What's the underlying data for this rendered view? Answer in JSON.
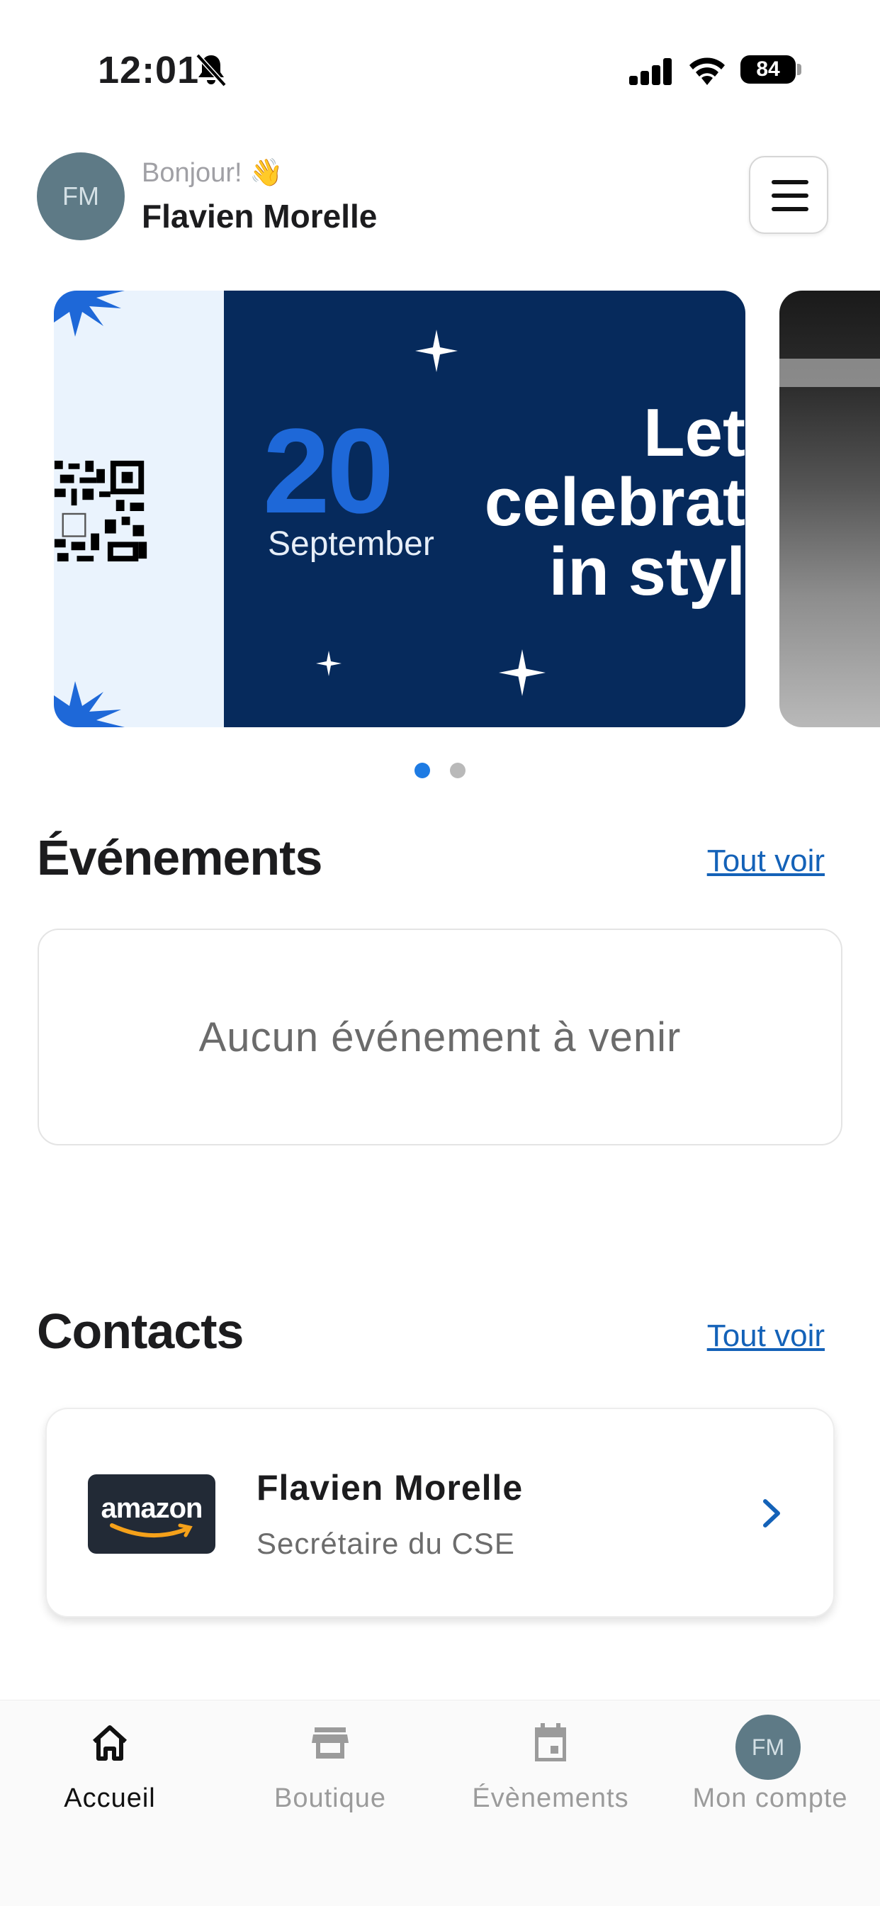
{
  "status_bar": {
    "time": "12:01",
    "battery": "84"
  },
  "header": {
    "avatar_initials": "FM",
    "greeting": "Bonjour! 👋",
    "user_name": "Flavien Morelle"
  },
  "carousel": {
    "banners": [
      {
        "day": "20",
        "month": "September",
        "tagline": "Let\ncelebrat\nin styl"
      }
    ],
    "page_count": 2,
    "active_index": 0
  },
  "events": {
    "title": "Événements",
    "see_all": "Tout voir",
    "empty_message": "Aucun événement à venir"
  },
  "contacts": {
    "title": "Contacts",
    "see_all": "Tout voir",
    "items": [
      {
        "logo_text": "amazon",
        "name": "Flavien Morelle",
        "role": "Secrétaire du CSE"
      }
    ]
  },
  "tab_bar": {
    "items": [
      {
        "label": "Accueil",
        "icon": "home-icon",
        "active": true
      },
      {
        "label": "Boutique",
        "icon": "store-icon",
        "active": false
      },
      {
        "label": "Évènements",
        "icon": "calendar-icon",
        "active": false
      },
      {
        "label": "Mon compte",
        "icon": "avatar",
        "active": false,
        "avatar_initials": "FM"
      }
    ]
  },
  "colors": {
    "accent": "#1e7be3",
    "link": "#1462b8",
    "banner_navy": "#062a5c",
    "avatar": "#5e7a86"
  }
}
